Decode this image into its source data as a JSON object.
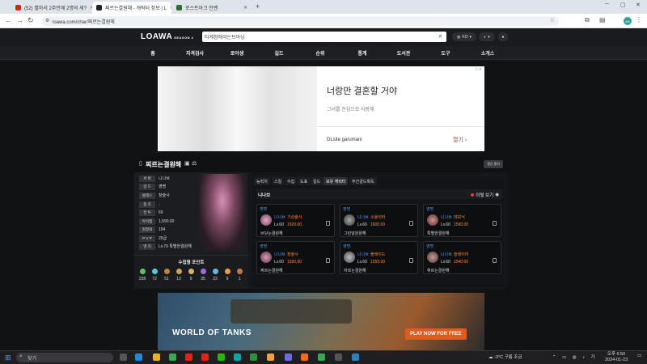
{
  "browser": {
    "tabs": [
      {
        "title": "(52) 별하서 2주만에 2명의 세?",
        "icon": "youtube-icon"
      },
      {
        "title": "찌르는결원해 - 캐릭터 정보 | L",
        "icon": "loawa-icon"
      },
      {
        "title": "로스트아크 인벤",
        "icon": "inven-icon"
      }
    ],
    "new_tab": "+",
    "url": "loawa.com/char/찌르는결원해",
    "profile_initial": "AN"
  },
  "site": {
    "logo": "LOAWA",
    "logo_sub": "SEASON 2",
    "search_value": "타계정에이는브아닝",
    "server_btn": "KO",
    "nav": [
      "홈",
      "자격검사",
      "로아생",
      "길드",
      "순위",
      "통계",
      "도서관",
      "도구",
      "소개스"
    ]
  },
  "ad_top": {
    "headline": "너랑만 결혼할 거야",
    "sub": "그녀를 진심으로 사랑해",
    "brand": "DLsite garumani",
    "cta": "열기 ›"
  },
  "profile": {
    "name": "찌르는결원해",
    "refresh": "갱신 중지",
    "stats": [
      {
        "label": "서 버",
        "value": "니나브"
      },
      {
        "label": "길 드",
        "value": "영명"
      },
      {
        "label": "클래스",
        "value": "창술사"
      },
      {
        "label": "칭 호",
        "value": "-"
      },
      {
        "label": "전 투",
        "value": "60"
      },
      {
        "label": "아이템",
        "value": "1,590.00"
      },
      {
        "label": "원정대",
        "value": "194"
      },
      {
        "label": "P V P",
        "value": "20급"
      },
      {
        "label": "영 지",
        "value": "Lv.70 특별한결원해"
      }
    ],
    "collection_title": "수집형 포인트",
    "collection": [
      {
        "icon": "island-heart-icon",
        "count": "228",
        "color": "#5fbf6a"
      },
      {
        "icon": "orpheus-star-icon",
        "count": "72",
        "color": "#5ac8d8"
      },
      {
        "icon": "giant-heart-icon",
        "count": "51",
        "color": "#b5863f"
      },
      {
        "icon": "art-icon",
        "count": "13",
        "color": "#c9a45e"
      },
      {
        "icon": "voyage-icon",
        "count": "9",
        "color": "#d3b466"
      },
      {
        "icon": "cosmos-icon",
        "count": "35",
        "color": "#a06bd6"
      },
      {
        "icon": "world-tree-icon",
        "count": "23",
        "color": "#6cb3e0"
      },
      {
        "icon": "mokoko-icon",
        "count": "9",
        "color": "#e7a23a"
      },
      {
        "icon": "ignea-icon",
        "count": "1",
        "color": "#c07a45"
      }
    ],
    "tabs": [
      "능력치",
      "스킬",
      "수집",
      "도표",
      "길드",
      "보유 캐릭터",
      "주간골드획득"
    ],
    "roster_owner": "니나브",
    "roster_view": "이렇 보기",
    "characters": [
      {
        "server": "영명",
        "class": "니나브",
        "name": "기상술사",
        "lv": "Lv.60",
        "ilvl": "1920.00",
        "nick": "브닷는결원해"
      },
      {
        "server": "영명",
        "class": "니나브",
        "name": "소울이터",
        "lv": "Lv.60",
        "ilvl": "1600.00",
        "nick": "그린달원원해"
      },
      {
        "server": "영명",
        "class": "니나브",
        "name": "데모닉",
        "lv": "Lv.60",
        "ilvl": "1590.00",
        "nick": "특별한결원해"
      },
      {
        "server": "영명",
        "class": "니나브",
        "name": "창술사",
        "lv": "Lv.60",
        "ilvl": "1590.00",
        "nick": "찌르는결원해"
      },
      {
        "server": "영명",
        "class": "니나브",
        "name": "블레이드",
        "lv": "Lv.60",
        "ilvl": "1555.00",
        "nick": "자르는결원해"
      },
      {
        "server": "영명",
        "class": "니나브",
        "name": "슬레이어",
        "lv": "Lv.60",
        "ilvl": "1540.00",
        "nick": "휘르는결원해"
      }
    ]
  },
  "ad_bottom": {
    "brand": "WORLD OF TANKS",
    "cta": "PLAY NOW FOR FREE"
  },
  "taskbar": {
    "search": "찾기",
    "weather": "-3°C 구름 조금",
    "time": "오후 6:50",
    "date": "2024-01-23"
  },
  "colors": {
    "accent_orange": "#ff8a3d",
    "accent_blue": "#5aa0ff",
    "page_bg": "#111214"
  }
}
